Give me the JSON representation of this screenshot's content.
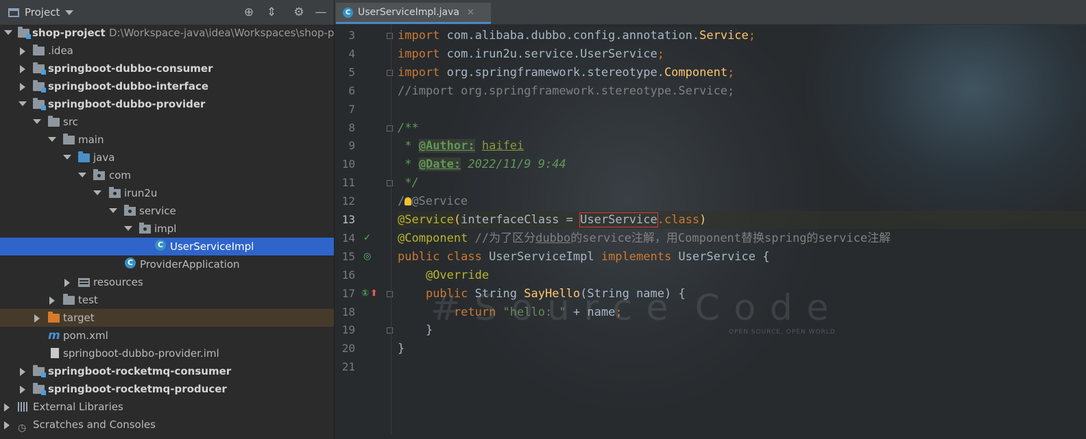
{
  "project_panel": {
    "title": "Project",
    "tree": [
      {
        "label": "shop-project",
        "path": "D:\\Workspace-java\\idea\\Workspaces\\shop-pro"
      },
      {
        "label": ".idea"
      },
      {
        "label": "springboot-dubbo-consumer"
      },
      {
        "label": "springboot-dubbo-interface"
      },
      {
        "label": "springboot-dubbo-provider"
      },
      {
        "label": "src"
      },
      {
        "label": "main"
      },
      {
        "label": "java"
      },
      {
        "label": "com"
      },
      {
        "label": "irun2u"
      },
      {
        "label": "service"
      },
      {
        "label": "impl"
      },
      {
        "label": "UserServiceImpl"
      },
      {
        "label": "ProviderApplication"
      },
      {
        "label": "resources"
      },
      {
        "label": "test"
      },
      {
        "label": "target"
      },
      {
        "label": "pom.xml"
      },
      {
        "label": "springboot-dubbo-provider.iml"
      },
      {
        "label": "springboot-rocketmq-consumer"
      },
      {
        "label": "springboot-rocketmq-producer"
      },
      {
        "label": "External Libraries"
      },
      {
        "label": "Scratches and Consoles"
      }
    ]
  },
  "editor": {
    "tab": {
      "label": "UserServiceImpl.java"
    },
    "current_line": 13,
    "lines": [
      {
        "n": "3",
        "segs": [
          [
            "kw",
            "import "
          ],
          [
            "pl",
            "com.alibaba.dubbo.config.annotation."
          ],
          [
            "fn",
            "Service"
          ],
          [
            "kw",
            ";"
          ]
        ]
      },
      {
        "n": "4",
        "segs": [
          [
            "kw",
            "import "
          ],
          [
            "pl",
            "com.irun2u.service.UserService"
          ],
          [
            "kw",
            ";"
          ]
        ]
      },
      {
        "n": "5",
        "segs": [
          [
            "kw",
            "import "
          ],
          [
            "pl",
            "org.springframework.stereotype."
          ],
          [
            "fn",
            "Component"
          ],
          [
            "kw",
            ";"
          ]
        ]
      },
      {
        "n": "6",
        "segs": [
          [
            "cmt",
            "//import org.springframework.stereotype.Service;"
          ]
        ]
      },
      {
        "n": "7",
        "segs": []
      },
      {
        "n": "8",
        "segs": [
          [
            "doc",
            "/**"
          ]
        ]
      },
      {
        "n": "9",
        "segs": [
          [
            "doc",
            " * "
          ],
          [
            "tag",
            "@Author:"
          ],
          [
            "doc",
            " "
          ],
          [
            "tagv",
            "haifei"
          ]
        ]
      },
      {
        "n": "10",
        "segs": [
          [
            "doc",
            " * "
          ],
          [
            "tag",
            "@Date:"
          ],
          [
            "doc",
            " 2022/11/9 9:44"
          ]
        ]
      },
      {
        "n": "11",
        "segs": [
          [
            "doc",
            " */"
          ]
        ]
      },
      {
        "n": "12",
        "segs": [
          [
            "cmt",
            "/"
          ],
          [
            "bulb",
            ""
          ],
          [
            "cmt",
            "@Service"
          ]
        ]
      },
      {
        "n": "13",
        "segs": [
          [
            "ann",
            "@Service"
          ],
          [
            "fn",
            "("
          ],
          [
            "pl",
            "interfaceClass = "
          ],
          [
            "box",
            "UserService"
          ],
          [
            "kw",
            "."
          ],
          [
            "kw",
            "class"
          ],
          [
            "fn",
            ")"
          ]
        ]
      },
      {
        "n": "14",
        "segs": [
          [
            "ann",
            "@Component "
          ],
          [
            "cmt",
            "//为了区分"
          ],
          [
            "cmtu",
            "dubbo"
          ],
          [
            "cmt",
            "的service注解，用Component替换spring的service注解"
          ]
        ]
      },
      {
        "n": "15",
        "segs": [
          [
            "kw",
            "public class "
          ],
          [
            "pl",
            "UserServiceImpl "
          ],
          [
            "kw",
            "implements "
          ],
          [
            "pl",
            "UserService {"
          ]
        ]
      },
      {
        "n": "16",
        "segs": [
          [
            "pl",
            "    "
          ],
          [
            "ann",
            "@Override"
          ]
        ]
      },
      {
        "n": "17",
        "segs": [
          [
            "pl",
            "    "
          ],
          [
            "kw",
            "public "
          ],
          [
            "pl",
            "String "
          ],
          [
            "fn",
            "SayHello"
          ],
          [
            "pl",
            "(String name) {"
          ]
        ]
      },
      {
        "n": "18",
        "segs": [
          [
            "pl",
            "        "
          ],
          [
            "kw",
            "return "
          ],
          [
            "str",
            "\"hello: \" "
          ],
          [
            "pl",
            "+ name"
          ],
          [
            "kw",
            ";"
          ]
        ]
      },
      {
        "n": "19",
        "segs": [
          [
            "pl",
            "    }"
          ]
        ]
      },
      {
        "n": "20",
        "segs": [
          [
            "pl",
            "}"
          ]
        ]
      },
      {
        "n": "21",
        "segs": []
      }
    ],
    "watermark_sub": "OPEN SOURCE, OPEN WORLD"
  },
  "colors": {
    "selection": "#2f65ca",
    "keyword": "#cc7832",
    "annotation": "#bbb529",
    "function": "#ffc66d",
    "string": "#6a8759",
    "comment": "#808080",
    "doc": "#629755",
    "plain": "#a9b7c6"
  }
}
